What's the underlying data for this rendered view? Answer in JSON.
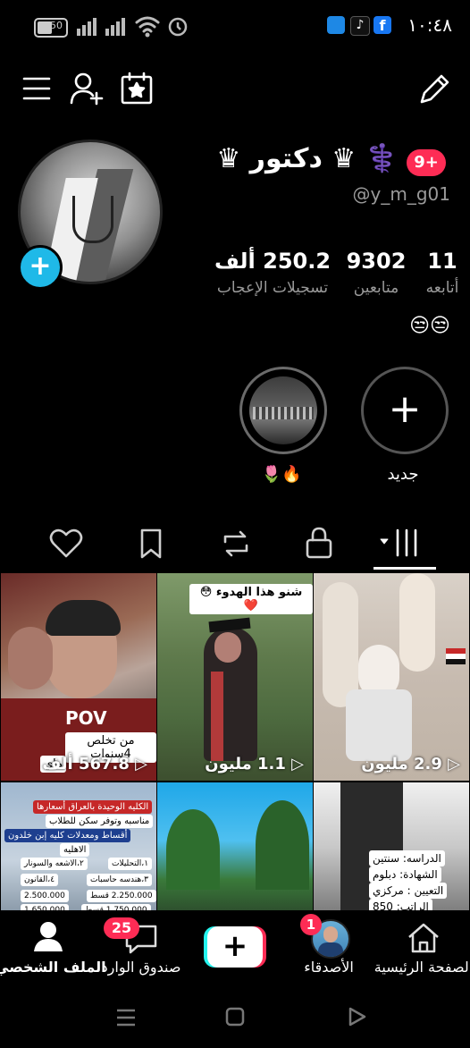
{
  "status_bar": {
    "time": "١٠:٤٨",
    "battery": "50"
  },
  "profile": {
    "display_name": "⚕️ ♛ دكتور ♛",
    "notification_badge": "9+",
    "username": "@y_m_g01",
    "stats": [
      {
        "value": "11",
        "label": "أتابعه"
      },
      {
        "value": "9302",
        "label": "متابعين"
      },
      {
        "value": "250.2 ألف",
        "label": "تسجيلات الإعجاب"
      }
    ],
    "bio": "😒😒"
  },
  "stories": {
    "new_label": "جديد",
    "highlight_label": "🌷🔥"
  },
  "videos": [
    {
      "views": "567.8 ألف",
      "overlay": "POV",
      "caption": [
        "من تخلص 4سنوات",
        "ماي"
      ]
    },
    {
      "views": "1.1 مليون",
      "caption": [
        "شنو هذا الهدوء 😳❤️"
      ]
    },
    {
      "views": "2.9 مليون",
      "caption": []
    },
    {
      "caption": [
        "الكليه الوحيدة بالعراق أسعارها",
        "مناسبه وتوفر سكن للطلاب",
        "أقساط ومعدلات كليه إبن خلدون",
        "الاهليه",
        "١،التحليلات",
        "٢،الاشعه والسونار",
        "٣،هندسه حاسبات",
        "٤،القانون",
        "2.250.000 قسط",
        "2.500.000",
        "1.750.000 قسط",
        "1.650.000"
      ]
    },
    {
      "caption": []
    },
    {
      "caption": [
        "الدراسه: سنتين",
        "الشهادة: دبلوم",
        "التعيين : مركزي",
        "الراتب: 850"
      ]
    }
  ],
  "bottom_nav": {
    "home": "الصفحة الرئيسية",
    "friends": "الأصدقاء",
    "friends_badge": "1",
    "inbox": "صندوق الوارد",
    "inbox_badge": "25",
    "profile": "الملف الشخصي"
  }
}
